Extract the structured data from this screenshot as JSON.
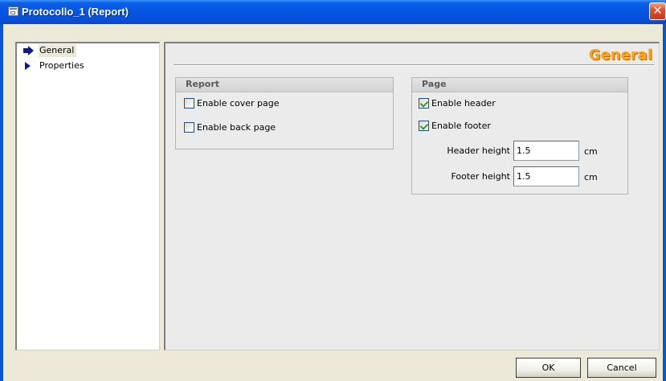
{
  "window": {
    "title": "Protocollo_1 (Report)",
    "close_glyph": "✕"
  },
  "nav": {
    "items": [
      {
        "label": "General",
        "icon": "blue-arrow-right-icon",
        "selected": true
      },
      {
        "label": "Properties",
        "icon": "blue-triangle-right-icon",
        "selected": false
      }
    ]
  },
  "content": {
    "section_title": "General",
    "report_group": {
      "title": "Report",
      "checkboxes": [
        {
          "label": "Enable cover page",
          "checked": false
        },
        {
          "label": "Enable back page",
          "checked": false
        }
      ]
    },
    "page_group": {
      "title": "Page",
      "checkboxes": [
        {
          "label": "Enable header",
          "checked": true
        },
        {
          "label": "Enable footer",
          "checked": true
        }
      ],
      "fields": [
        {
          "label": "Header height",
          "value": "1.5",
          "unit": "cm"
        },
        {
          "label": "Footer height",
          "value": "1.5",
          "unit": "cm"
        }
      ]
    }
  },
  "footer": {
    "ok_label": "OK",
    "cancel_label": "Cancel"
  },
  "colors": {
    "titlebar": "#0554e3",
    "section_title": "#f7a320",
    "client_bg": "#ece9d8",
    "checkmark": "#21a121"
  }
}
